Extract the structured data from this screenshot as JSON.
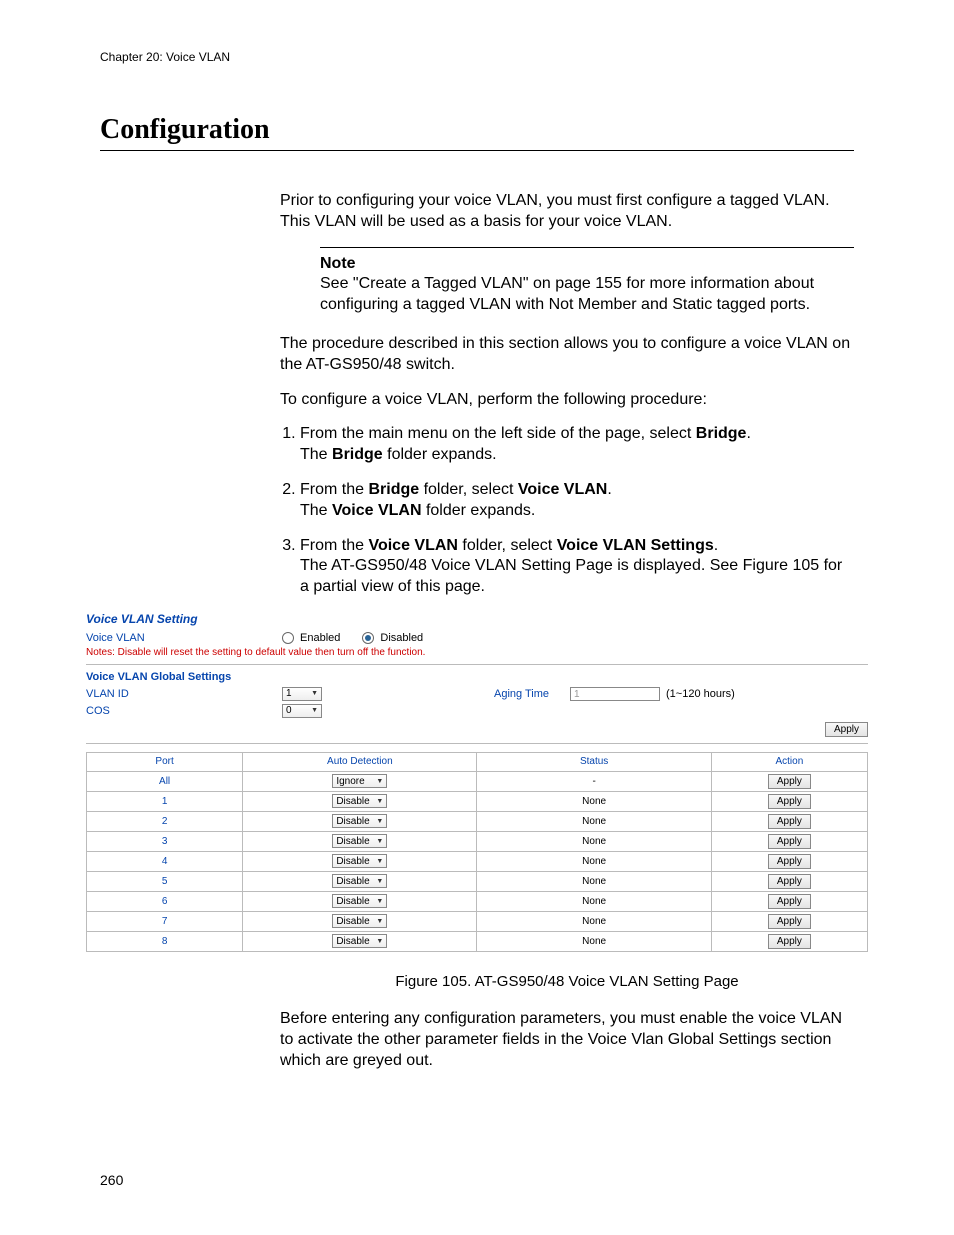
{
  "chapter": "Chapter 20: Voice VLAN",
  "heading": "Configuration",
  "intro": "Prior to configuring your voice VLAN, you must first configure a tagged VLAN. This VLAN will be used as a basis for your voice VLAN.",
  "note_title": "Note",
  "note_body": "See \"Create a Tagged VLAN\" on page 155 for more information about configuring a tagged VLAN with Not Member and Static tagged ports.",
  "para2": "The procedure described in this section allows you to configure a voice VLAN on the AT-GS950/48 switch.",
  "para3": "To configure a voice VLAN, perform the following procedure:",
  "steps": {
    "s1a": "From the main menu on the left side of the page, select ",
    "s1b": "Bridge",
    "s1c": ".",
    "s1d": "The ",
    "s1e": "Bridge",
    "s1f": " folder expands.",
    "s2a": "From the ",
    "s2b": "Bridge",
    "s2c": " folder, select ",
    "s2d": "Voice VLAN",
    "s2e": ".",
    "s2f": "The ",
    "s2g": "Voice VLAN",
    "s2h": " folder expands.",
    "s3a": "From the ",
    "s3b": "Voice VLAN",
    "s3c": " folder, select ",
    "s3d": "Voice VLAN Settings",
    "s3e": ".",
    "s3f": "The AT-GS950/48 Voice VLAN Setting Page is displayed. See Figure 105 for a partial view of this page."
  },
  "ui": {
    "title": "Voice VLAN Setting",
    "voice_vlan_label": "Voice VLAN",
    "enabled": "Enabled",
    "disabled": "Disabled",
    "warning": "Notes: Disable will reset the setting to default value then turn off the function.",
    "global_title": "Voice VLAN Global Settings",
    "vlan_id_label": "VLAN ID",
    "vlan_id_value": "1",
    "aging_label": "Aging Time",
    "aging_value": "1",
    "aging_hint": "(1~120 hours)",
    "cos_label": "COS",
    "cos_value": "0",
    "apply": "Apply",
    "headers": {
      "port": "Port",
      "auto": "Auto Detection",
      "status": "Status",
      "action": "Action"
    },
    "rows": [
      {
        "port": "All",
        "auto": "Ignore",
        "status": "-"
      },
      {
        "port": "1",
        "auto": "Disable",
        "status": "None"
      },
      {
        "port": "2",
        "auto": "Disable",
        "status": "None"
      },
      {
        "port": "3",
        "auto": "Disable",
        "status": "None"
      },
      {
        "port": "4",
        "auto": "Disable",
        "status": "None"
      },
      {
        "port": "5",
        "auto": "Disable",
        "status": "None"
      },
      {
        "port": "6",
        "auto": "Disable",
        "status": "None"
      },
      {
        "port": "7",
        "auto": "Disable",
        "status": "None"
      },
      {
        "port": "8",
        "auto": "Disable",
        "status": "None"
      }
    ]
  },
  "caption": "Figure 105. AT-GS950/48 Voice VLAN Setting Page",
  "closing": "Before entering any configuration parameters, you must enable the voice VLAN to activate the other parameter fields in the Voice Vlan Global Settings section which are greyed out.",
  "page_number": "260"
}
